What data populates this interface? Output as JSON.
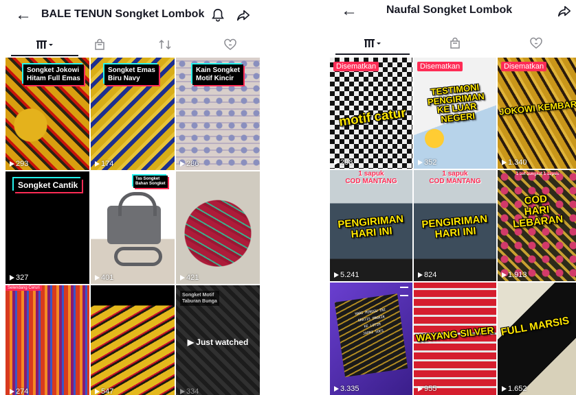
{
  "left": {
    "title": "BALE TENUN Songket Lombok",
    "tiles": [
      {
        "caption": "Songket Jokowi\nHitam Full Emas",
        "views": "293"
      },
      {
        "caption": "Songket Emas\nBiru Navy",
        "views": "174"
      },
      {
        "caption": "Kain Songket\nMotif Kincir",
        "views": "286"
      },
      {
        "caption": "Songket Cantik",
        "views": "327"
      },
      {
        "caption": "Tas Songket\nBahan Songket",
        "views": "401"
      },
      {
        "caption": "",
        "views": "421"
      },
      {
        "caption": "Selendang Ceruri",
        "views": "274"
      },
      {
        "caption": "",
        "views": "547"
      },
      {
        "caption": "Songket Motif\nTaburan Bunga",
        "views": "334",
        "overlay": "Just watched"
      }
    ]
  },
  "right": {
    "title": "Naufal Songket Lombok",
    "pinned_label": "Disematkan",
    "tiles": [
      {
        "text": "motif catur",
        "views": "298",
        "pinned": true
      },
      {
        "text": "TESTIMONI\nPENGIRIMAN\nKE LUAR NEGERI",
        "views": "352",
        "pinned": true
      },
      {
        "text": "JOKOWI KEMBAR",
        "views": "1.340",
        "pinned": true
      },
      {
        "top": "1 sapuk\nCOD MANTANG",
        "text": "PENGIRIMAN\nHARI INI",
        "views": "5.241"
      },
      {
        "top": "1 sapuk\nCOD MANTANG",
        "text": "PENGIRIMAN\nHARI INI",
        "views": "824"
      },
      {
        "top": "1 set songket 1 sapuk",
        "text": "COD\nHARI LEBARAN",
        "views": "1.913"
      },
      {
        "text": "HARI MINGGU INI\nGRATIS ONGKIR\nKE LOTIM\nJAPRI SOES",
        "views": "3.335"
      },
      {
        "text": "WAYANG SILVER",
        "views": "955"
      },
      {
        "text": "FULL MARSIS",
        "views": "1.652"
      }
    ]
  }
}
